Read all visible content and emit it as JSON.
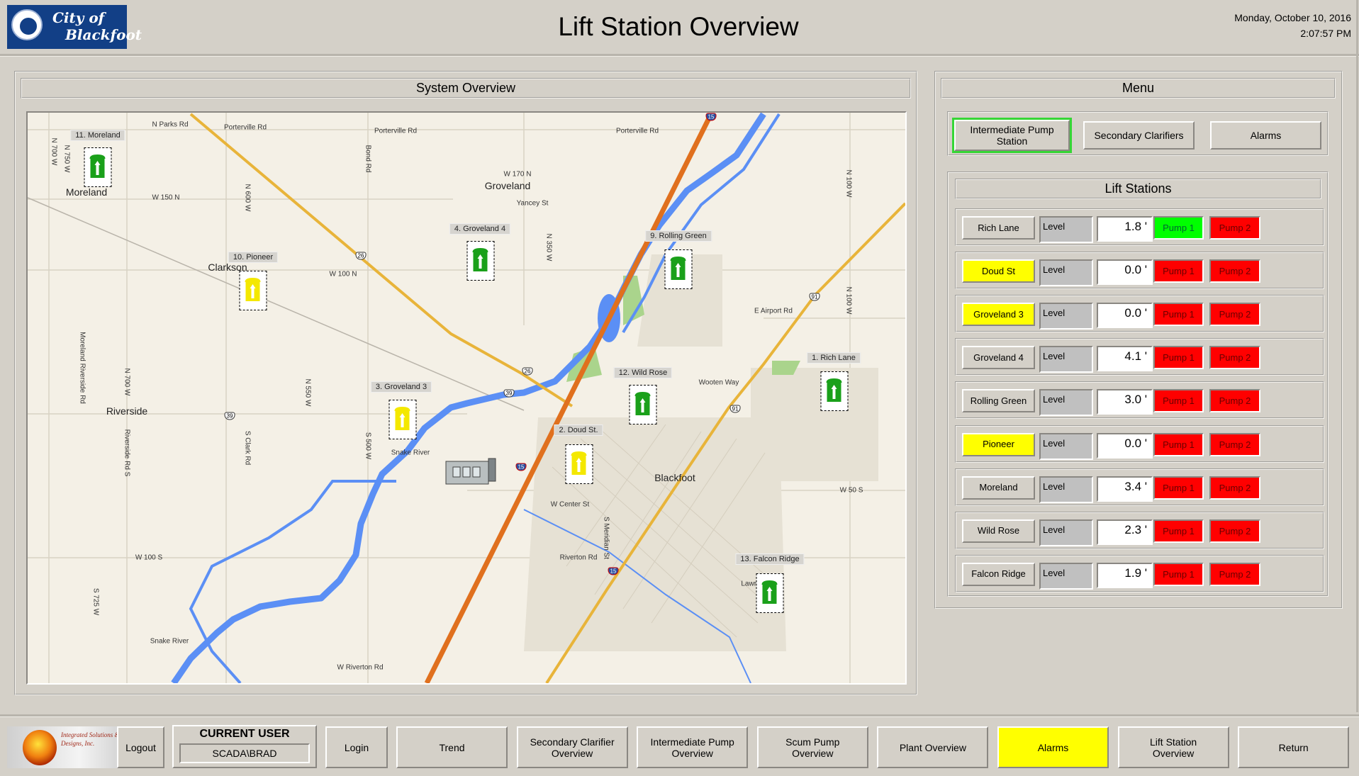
{
  "header": {
    "logo_text": "City of Blackfoot",
    "title": "Lift Station Overview",
    "date": "Monday, October 10, 2016",
    "time": "2:07:57 PM"
  },
  "system_overview": {
    "title": "System Overview",
    "stations": [
      {
        "label": "11. Moreland",
        "status_color": "#1aa01a"
      },
      {
        "label": "10. Pioneer",
        "status_color": "#f4e800"
      },
      {
        "label": "4. Groveland 4",
        "status_color": "#1aa01a"
      },
      {
        "label": "9. Rolling Green",
        "status_color": "#1aa01a"
      },
      {
        "label": "3. Groveland 3",
        "status_color": "#f4e800"
      },
      {
        "label": "12. Wild Rose",
        "status_color": "#1aa01a"
      },
      {
        "label": "1. Rich Lane",
        "status_color": "#1aa01a"
      },
      {
        "label": "2. Doud St.",
        "status_color": "#f4e800"
      },
      {
        "label": "13. Falcon Ridge",
        "status_color": "#1aa01a"
      }
    ],
    "place_labels": [
      "Moreland",
      "Groveland",
      "Clarkson",
      "Riverside",
      "Blackfoot"
    ],
    "road_labels": [
      "N Parks Rd",
      "Porterville Rd",
      "Porterville Rd",
      "Porterville Rd",
      "W 170 N",
      "Yancey St",
      "W 150 N",
      "W 100 N",
      "E Airport Rd",
      "Wooten Way",
      "W Center St",
      "Riverton Rd",
      "W 50 S",
      "W 100 S",
      "W Riverton Rd",
      "Snake River",
      "Snake River",
      "Lawre"
    ],
    "vertical_road_labels": [
      "N 700 W",
      "N 750 W",
      "N 600 W",
      "Bond Rd",
      "N 350 W",
      "N 100 W",
      "N 100 W",
      "N 550 W",
      "N 700 W",
      "S 500 W",
      "S Clark Rd",
      "S Meridian St",
      "Moreland Riverside Rd",
      "Riverside Rd S",
      "S 725 W"
    ],
    "shields": [
      "15",
      "26",
      "26",
      "39",
      "39",
      "91",
      "91",
      "15",
      "15"
    ]
  },
  "menu": {
    "title": "Menu",
    "buttons": [
      {
        "label": "Intermediate Pump Station",
        "selected": true
      },
      {
        "label": "Secondary Clarifiers",
        "selected": false
      },
      {
        "label": "Alarms",
        "selected": false
      }
    ],
    "lift_stations": {
      "title": "Lift Stations",
      "level_label": "Level",
      "pump1_label": "Pump 1",
      "pump2_label": "Pump 2",
      "colors": {
        "normal": "#d4d0c8",
        "alarm": "#ffff00",
        "running": "#00ff00",
        "stopped": "#ff0000"
      },
      "rows": [
        {
          "name": "Rich Lane",
          "name_state": "normal",
          "level": "1.8 '",
          "pump1": "running",
          "pump2": "stopped"
        },
        {
          "name": "Doud St",
          "name_state": "alarm",
          "level": "0.0 '",
          "pump1": "stopped",
          "pump2": "stopped"
        },
        {
          "name": "Groveland 3",
          "name_state": "alarm",
          "level": "0.0 '",
          "pump1": "stopped",
          "pump2": "stopped"
        },
        {
          "name": "Groveland 4",
          "name_state": "normal",
          "level": "4.1 '",
          "pump1": "stopped",
          "pump2": "stopped"
        },
        {
          "name": "Rolling Green",
          "name_state": "normal",
          "level": "3.0 '",
          "pump1": "stopped",
          "pump2": "stopped"
        },
        {
          "name": "Pioneer",
          "name_state": "alarm",
          "level": "0.0 '",
          "pump1": "stopped",
          "pump2": "stopped"
        },
        {
          "name": "Moreland",
          "name_state": "normal",
          "level": "3.4 '",
          "pump1": "stopped",
          "pump2": "stopped"
        },
        {
          "name": "Wild Rose",
          "name_state": "normal",
          "level": "2.3 '",
          "pump1": "stopped",
          "pump2": "stopped"
        },
        {
          "name": "Falcon Ridge",
          "name_state": "normal",
          "level": "1.9 '",
          "pump1": "stopped",
          "pump2": "stopped"
        }
      ]
    }
  },
  "footer": {
    "company_logo": "Integrated Solutions & Designs, Inc.",
    "logout": "Logout",
    "current_user_label": "CURRENT USER",
    "current_user": "SCADA\\BRAD",
    "login": "Login",
    "nav": [
      {
        "label": "Trend",
        "highlight": false
      },
      {
        "label": "Secondary Clarifier Overview",
        "highlight": false
      },
      {
        "label": "Intermediate Pump Overview",
        "highlight": false
      },
      {
        "label": "Scum Pump Overview",
        "highlight": false
      },
      {
        "label": "Plant Overview",
        "highlight": false
      },
      {
        "label": "Alarms",
        "highlight": true
      },
      {
        "label": "Lift Station Overview",
        "highlight": false
      },
      {
        "label": "Return",
        "highlight": false
      }
    ]
  }
}
